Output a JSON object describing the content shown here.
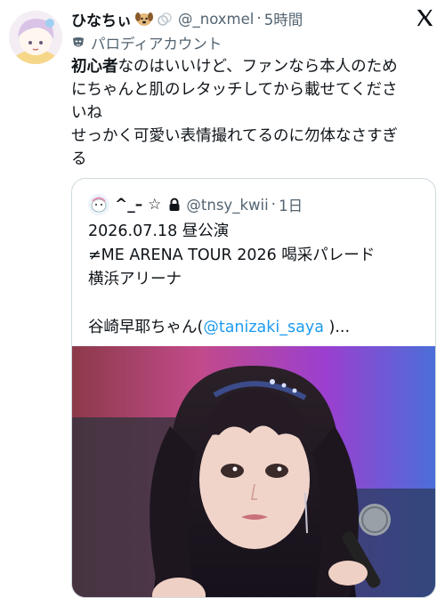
{
  "tweet": {
    "display_name": "ひなちぃ",
    "handle": "@_noxmel",
    "separator": "·",
    "time": "5時間",
    "label": "パロディアカウント",
    "body": {
      "line1_bold": "初心者",
      "line1_rest": "なのはいいけど、ファンなら本人のため",
      "line2": "にちゃんと肌のレタッチしてから載せてくださ",
      "line3": "いね",
      "line4": "せっかく可愛い表情撮れてるのに勿体なさすぎ",
      "line5": "る"
    }
  },
  "quote": {
    "display_name": "^_– ☆",
    "handle": "@tnsy_kwii",
    "separator": "·",
    "time": "1日",
    "lines": {
      "l1": "2026.07.18 昼公演",
      "l2": "≠ME ARENA TOUR 2026 喝采パレード",
      "l3": "横浜アリーナ",
      "l5_before": "谷崎早耶ちゃん(",
      "l5_mention": "@tanizaki_saya",
      "l5_after": " )..."
    }
  },
  "icons": {
    "x_logo": "x-logo-icon",
    "parody": "parody-mask-icon",
    "lock": "lock-icon",
    "emoji_dog": "dog-emoji-icon",
    "emoji_rings": "rings-emoji-icon"
  },
  "colors": {
    "text": "#0f1419",
    "muted": "#536471",
    "link": "#1d9bf0",
    "border": "#cfd9de"
  }
}
